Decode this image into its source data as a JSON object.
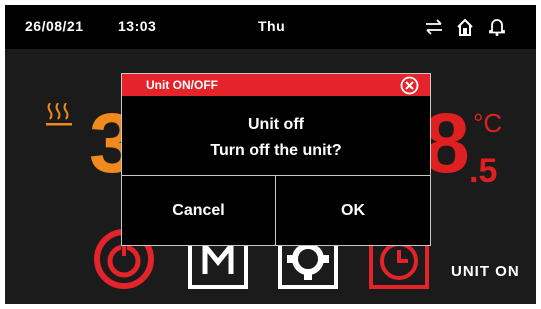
{
  "statusbar": {
    "date": "26/08/21",
    "time": "13:03",
    "day": "Thu"
  },
  "dashboard": {
    "left_value": "3",
    "right_value": "8",
    "right_decimal": ".5",
    "temp_unit": "°C",
    "unit_status": "UNIT ON"
  },
  "dialog": {
    "title": "Unit ON/OFF",
    "message_title": "Unit off",
    "message_body": "Turn off the unit?",
    "cancel_label": "Cancel",
    "ok_label": "OK"
  },
  "colors": {
    "accent_red": "#e4232a",
    "accent_orange": "#f08a1c"
  }
}
